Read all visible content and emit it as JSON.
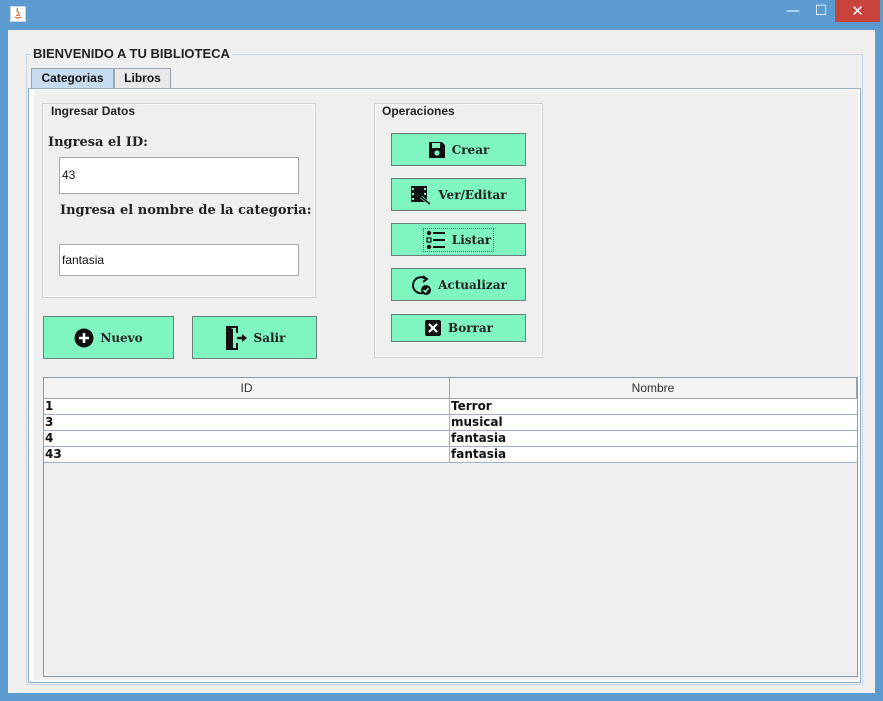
{
  "window": {
    "icon": "java-icon",
    "controls": {
      "minimize": "—",
      "maximize": "☐",
      "close": "✕"
    }
  },
  "main": {
    "group_title": "BIENVENIDO A TU BIBLIOTECA",
    "tabs": [
      {
        "label": "Categorias",
        "selected": true
      },
      {
        "label": "Libros",
        "selected": false
      }
    ]
  },
  "form": {
    "panel_title": "Ingresar Datos",
    "id_label": "Ingresa el ID:",
    "id_value": "43",
    "nombre_label": "Ingresa el nombre de la categoria:",
    "nombre_value": "fantasia"
  },
  "operations": {
    "panel_title": "Operaciones",
    "buttons": [
      {
        "label": "Crear",
        "icon": "save-icon"
      },
      {
        "label": "Ver/Editar",
        "icon": "film-edit-icon"
      },
      {
        "label": "Listar",
        "icon": "list-icon"
      },
      {
        "label": "Actualizar",
        "icon": "refresh-check-icon"
      },
      {
        "label": "Borrar",
        "icon": "close-box-icon"
      }
    ]
  },
  "actions": {
    "nuevo": {
      "label": "Nuevo",
      "icon": "plus-circle-icon"
    },
    "salir": {
      "label": "Salir",
      "icon": "exit-door-icon"
    }
  },
  "table": {
    "columns": [
      "ID",
      "Nombre"
    ],
    "rows": [
      [
        "1",
        "Terror"
      ],
      [
        "3",
        "musical"
      ],
      [
        "4",
        "fantasia"
      ],
      [
        "43",
        "fantasia"
      ]
    ]
  },
  "colors": {
    "button_bg": "#7ff5c0",
    "titlebar": "#5b9bd0",
    "close": "#c7433b",
    "tab_selected": "#c6dcf1"
  }
}
